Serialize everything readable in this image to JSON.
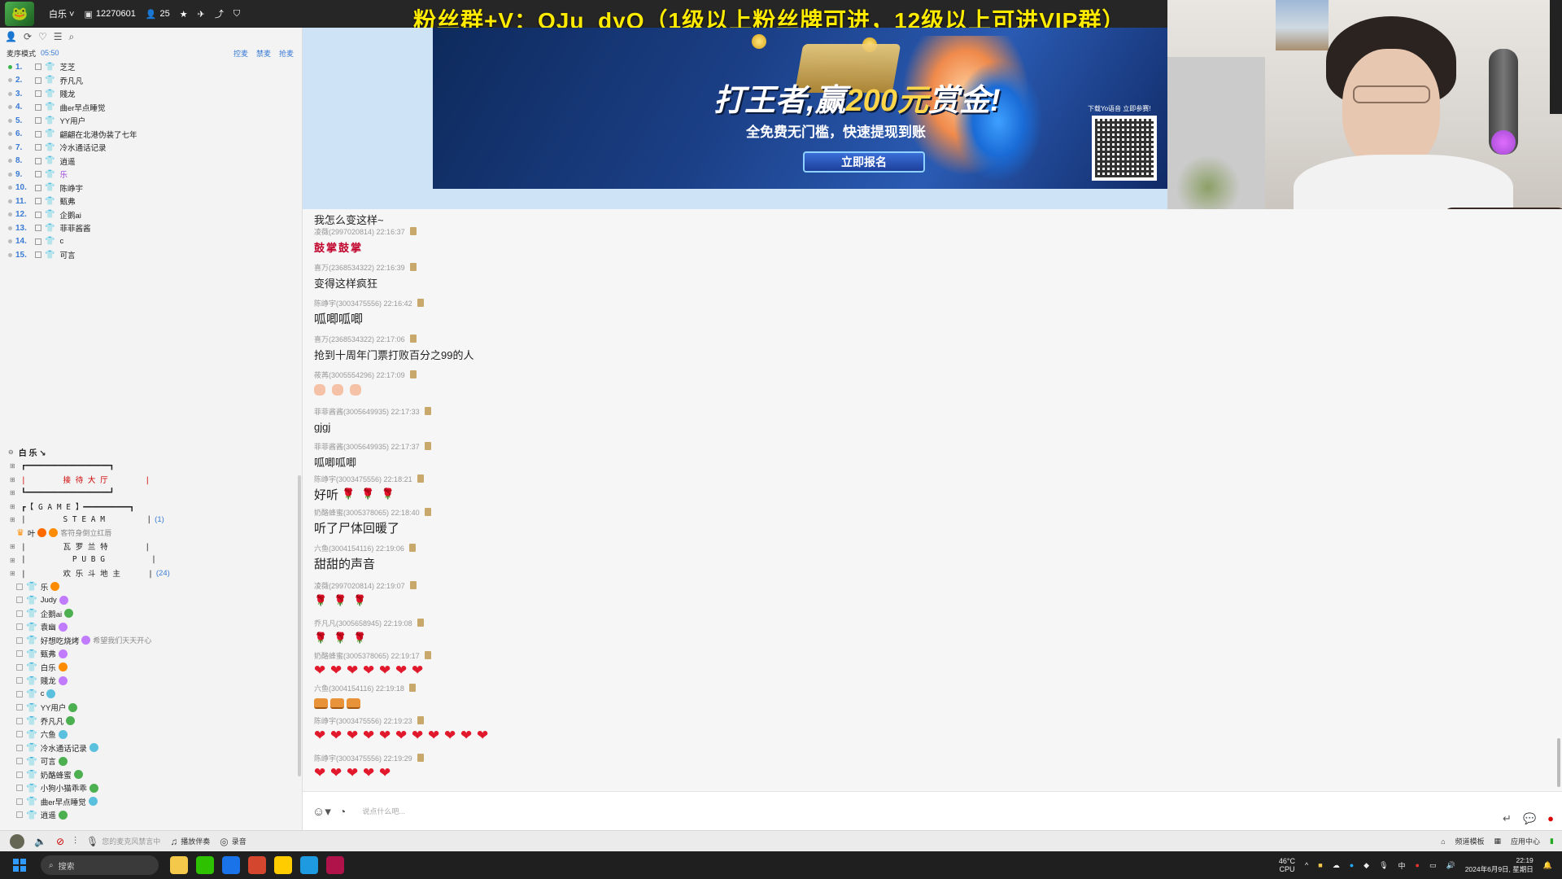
{
  "topbar": {
    "channel_name": "白乐 ˅",
    "channel_id": "12270601",
    "online_count": "25",
    "banner_text": "粉丝群+V：OJu_dyO（1级以上粉丝牌可进，12级以上可进VIP群）"
  },
  "left_panel": {
    "mode_label": "麦序模式",
    "mode_timer": "05:50",
    "links": [
      "控麦",
      "禁麦",
      "抢麦"
    ],
    "queue": [
      {
        "num": "1.",
        "name": "芝芝"
      },
      {
        "num": "2.",
        "name": "乔凡凡"
      },
      {
        "num": "3.",
        "name": "賤龙"
      },
      {
        "num": "4.",
        "name": "曲er早点睡觉"
      },
      {
        "num": "5.",
        "name": "YY用户"
      },
      {
        "num": "6.",
        "name": "翩翩在北港伪装了七年"
      },
      {
        "num": "7.",
        "name": "冷水通话记录"
      },
      {
        "num": "8.",
        "name": "逍遥"
      },
      {
        "num": "9.",
        "name": "乐"
      },
      {
        "num": "10.",
        "name": "陈峥宇"
      },
      {
        "num": "11.",
        "name": "甄弗"
      },
      {
        "num": "12.",
        "name": "企鹅ai"
      },
      {
        "num": "13.",
        "name": "菲菲酱酱"
      },
      {
        "num": "14.",
        "name": "c"
      },
      {
        "num": "15.",
        "name": "可言"
      }
    ]
  },
  "channel_tree": {
    "root": "白 乐 ↘",
    "channels": [
      {
        "text": "┏━━━━━━━━━━━━━━━━━━┓",
        "red": false,
        "count": ""
      },
      {
        "text": "|        接 待 大 厅        |",
        "red": true,
        "count": ""
      },
      {
        "text": "┗━━━━━━━━━━━━━━━━━━┛",
        "red": false,
        "count": ""
      },
      {
        "text": "┏【 G A M E 】━━━━━━━━━━┓",
        "red": false,
        "count": ""
      },
      {
        "text": "|        S T E A M         |",
        "red": false,
        "count": "(1)"
      }
    ],
    "steam_user": {
      "name": "叶",
      "sig": "客符身倒立红唇"
    },
    "channels2": [
      {
        "text": "|        瓦 罗 兰 特        |",
        "count": ""
      },
      {
        "text": "|          P U B G          |",
        "count": ""
      },
      {
        "text": "|        欢 乐 斗 地 主      |",
        "count": "(24)"
      }
    ],
    "users": [
      {
        "name": "乐",
        "badge": "#ff8c00",
        "sig": ""
      },
      {
        "name": "Judy",
        "badge": "#c17bff",
        "sig": ""
      },
      {
        "name": "企鹅ai",
        "badge": "#4caf50",
        "sig": ""
      },
      {
        "name": "袁幽",
        "badge": "#c17bff",
        "sig": ""
      },
      {
        "name": "好想吃烧烤",
        "badge": "#c17bff",
        "sig": "希望我们天天开心"
      },
      {
        "name": "甄弗",
        "badge": "#c17bff",
        "sig": ""
      },
      {
        "name": "白乐",
        "badge": "#ff8c00",
        "sig": ""
      },
      {
        "name": "賤龙",
        "badge": "#c17bff",
        "sig": ""
      },
      {
        "name": "c",
        "badge": "#5bc0de",
        "sig": ""
      },
      {
        "name": "YY用户",
        "badge": "#4caf50",
        "sig": ""
      },
      {
        "name": "乔凡凡",
        "badge": "#4caf50",
        "sig": ""
      },
      {
        "name": "六鱼",
        "badge": "#5bc0de",
        "sig": ""
      },
      {
        "name": "冷水通话记录",
        "badge": "#5bc0de",
        "sig": ""
      },
      {
        "name": "可言",
        "badge": "#4caf50",
        "sig": ""
      },
      {
        "name": "奶酪蜂蜜",
        "badge": "#4caf50",
        "sig": ""
      },
      {
        "name": "小狗小猫乖乖",
        "badge": "#4caf50",
        "sig": ""
      },
      {
        "name": "曲er早点睡觉",
        "badge": "#5bc0de",
        "sig": ""
      },
      {
        "name": "逍遥",
        "badge": "#4caf50",
        "sig": ""
      }
    ]
  },
  "ad": {
    "headline_a": "打王者,赢",
    "headline_b": "200元",
    "headline_c": "赏金!",
    "subline": "全免费无门槛，快速提现到账",
    "cta": "立即报名",
    "qr_label": "下载Yo语音 立即参赛!"
  },
  "chat": {
    "messages": [
      {
        "meta": "",
        "text": "我怎么变这样~",
        "kind": "plain"
      },
      {
        "meta": "凌薇(2997020814) 22:16:37",
        "text": "鼓掌鼓掌",
        "kind": "red"
      },
      {
        "meta": "喜万(2368534322) 22:16:39",
        "text": "变得这样疯狂",
        "kind": "plain"
      },
      {
        "meta": "陈峥宇(3003475556) 22:16:42",
        "text": "呱唧呱唧",
        "kind": "big"
      },
      {
        "meta": "喜万(2368534322) 22:17:06",
        "text": "抢到十周年门票打败百分之99的人",
        "kind": "plain"
      },
      {
        "meta": "莜苒(3005554296) 22:17:09",
        "text": "",
        "kind": "palms"
      },
      {
        "meta": "菲菲酱酱(3005649935) 22:17:33",
        "text": "gjgj",
        "kind": "plain"
      },
      {
        "meta": "菲菲酱酱(3005649935) 22:17:37",
        "text": "呱唧呱唧",
        "kind": "plain"
      },
      {
        "meta": "陈峥宇(3003475556) 22:18:21",
        "text": "好听",
        "kind": "roses3"
      },
      {
        "meta": "奶酪蜂蜜(3005378065) 22:18:40",
        "text": "听了尸体回暖了",
        "kind": "big"
      },
      {
        "meta": "六鱼(3004154116) 22:19:06",
        "text": "甜甜的声音",
        "kind": "big"
      },
      {
        "meta": "凌薇(2997020814) 22:19:07",
        "text": "",
        "kind": "roses"
      },
      {
        "meta": "乔凡凡(3005658945) 22:19:08",
        "text": "",
        "kind": "roses"
      },
      {
        "meta": "奶酪蜂蜜(3005378065) 22:19:17",
        "text": "",
        "kind": "hearts7"
      },
      {
        "meta": "六鱼(3004154116) 22:19:18",
        "text": "",
        "kind": "pots"
      },
      {
        "meta": "陈峥宇(3003475556) 22:19:23",
        "text": "",
        "kind": "hearts11"
      },
      {
        "meta": "陈峥宇(3003475556) 22:19:29",
        "text": "",
        "kind": "hearts5"
      }
    ]
  },
  "input": {
    "placeholder": "说点什么吧..."
  },
  "statusbar": {
    "mic_hint": "您的麦克风禁言中",
    "music": "播放伴奏",
    "record": "录音",
    "right1": "频道模板",
    "right2": "应用中心"
  },
  "taskbar": {
    "search": "搜索",
    "weather_temp": "46°C",
    "weather_label": "CPU",
    "ime": "中",
    "time": "22:19",
    "date": "2024年6月9日, 星期日"
  }
}
